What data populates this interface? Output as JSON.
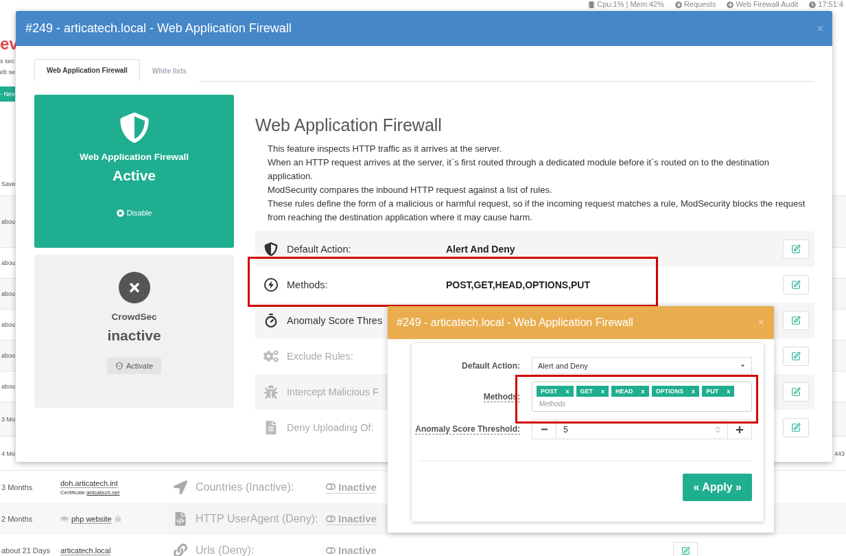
{
  "status_bar": [
    {
      "kind": "chip",
      "text": "Cpu:1% | Mem:42%"
    },
    {
      "kind": "circle",
      "text": "Requests"
    },
    {
      "kind": "circle",
      "text": "Web Firewall Audit"
    },
    {
      "kind": "clock",
      "text": "17:51:4"
    }
  ],
  "background": {
    "heading": "ev",
    "intro_lines": [
      "s sec",
      "eb se"
    ],
    "new_button": "- Nev",
    "column_header": "Save",
    "hidden_rows": [
      {
        "age": "abou"
      },
      {
        "age": "abou"
      },
      {
        "age": "abou"
      },
      {
        "age": "abou"
      },
      {
        "age": "abou"
      },
      {
        "age": "abou"
      },
      {
        "age": "3 Mo"
      },
      {
        "age": "4 Mo",
        "port": "443"
      }
    ],
    "rows": [
      {
        "age": "3 Months",
        "site": "doh.articatech.int",
        "kind": "certificate",
        "certificate_label": "Certificate:",
        "certificate": "articatech.net"
      },
      {
        "age": "2 Months",
        "site": "php website",
        "kind": "php"
      },
      {
        "age": "about 21 Days",
        "site": "articatech.local",
        "kind": "plain"
      }
    ],
    "rules": [
      {
        "kind": "location",
        "label": "Countries (Inactive):",
        "value": "Inactive"
      },
      {
        "kind": "file-code",
        "label": "HTTP UserAgent (Deny):",
        "value": "Inactive"
      },
      {
        "kind": "link",
        "label": "Urls (Deny):",
        "value": "Inactive"
      }
    ]
  },
  "modal": {
    "title": "#249 - articatech.local - Web Application Firewall",
    "close": "×",
    "tabs": [
      {
        "label": "Web Application Firewall",
        "selected": true
      },
      {
        "label": "White lists",
        "selected": false
      }
    ],
    "cards": [
      {
        "title": "Web Application Firewall",
        "status": "Active",
        "action": "Disable",
        "active": true
      },
      {
        "title": "CrowdSec",
        "status": "inactive",
        "action": "Activate",
        "active": false
      }
    ],
    "heading": "Web Application Firewall",
    "description": [
      "This feature inspects HTTP traffic as it arrives at the server.",
      "When an HTTP request arrives at the server, it`s first routed through a dedicated module before it`s routed on to the destination application.",
      "ModSecurity compares the inbound HTTP request against a list of rules.",
      "These rules define the form of a malicious or harmful request, so if the incoming request matches a rule, ModSecurity blocks the request from reaching the destination application where it may cause harm."
    ],
    "settings": [
      {
        "kind": "shield",
        "label": "Default Action:",
        "value": "Alert And Deny",
        "disabled": false
      },
      {
        "kind": "bolt",
        "label": "Methods:",
        "value": "POST,GET,HEAD,OPTIONS,PUT",
        "disabled": false
      },
      {
        "kind": "timer",
        "label": "Anomaly Score Thres",
        "disabled": false
      },
      {
        "kind": "cogs",
        "label": "Exclude Rules:",
        "disabled": true
      },
      {
        "kind": "bug",
        "label": "Intercept Malicious F",
        "disabled": true
      },
      {
        "kind": "file",
        "label": "Deny Uploading Of:",
        "disabled": true
      }
    ]
  },
  "dialog": {
    "title": "#249 - articatech.local - Web Application Firewall",
    "close": "×",
    "default_action": {
      "label": "Default Action:",
      "value": "Alert and Deny"
    },
    "methods": {
      "label": "Methods:",
      "tags": [
        {
          "label": "POST",
          "remove": "x"
        },
        {
          "label": "GET",
          "remove": "x"
        },
        {
          "label": "HEAD",
          "remove": "x"
        },
        {
          "label": "OPTIONS",
          "remove": "x"
        },
        {
          "label": "PUT",
          "remove": "x"
        }
      ],
      "placeholder": "Methods"
    },
    "threshold": {
      "label": "Anomaly Score Threshold:",
      "value": "5"
    },
    "apply": "« Apply »"
  }
}
